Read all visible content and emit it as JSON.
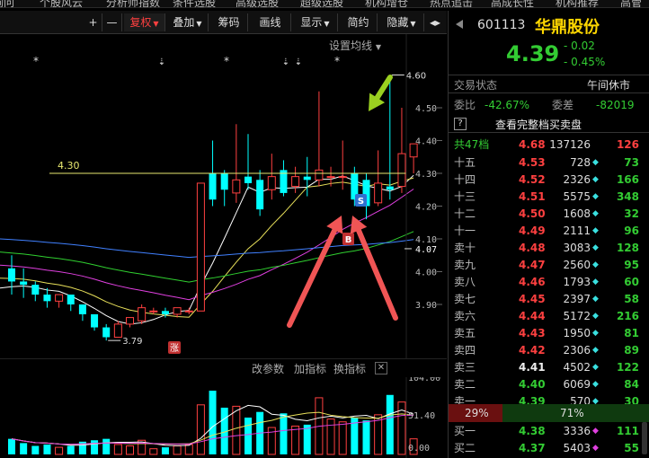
{
  "top_tabs": [
    "询问",
    "个股风云",
    "分析师指数",
    "条件选股",
    "高级选股",
    "超级选股",
    "机构增仓",
    "热点追击",
    "高成长性",
    "机构推荐",
    "高管"
  ],
  "toolbar": {
    "plus": "+",
    "minus": "—",
    "fuquan": "复权",
    "diejia": "叠加",
    "chouma": "筹码",
    "huaxian": "画线",
    "xianshi": "显示",
    "jianyue": "简约",
    "yincang": "隐藏"
  },
  "chart": {
    "settings_label": "设置均线",
    "price_ticks": [
      "4.50",
      "4.40",
      "4.30",
      "4.20",
      "4.10",
      "4.00",
      "3.90"
    ],
    "current_price_tag": "4.07",
    "high_label": "4.60",
    "low_label": "3.79",
    "hline_label": "4.30",
    "badge_zhang": "涨",
    "badge_s": "S",
    "badge_b": "B",
    "star": "*",
    "arrow_down": "⇣",
    "candles": [
      {
        "o": 4.01,
        "c": 3.97,
        "h": 4.05,
        "l": 3.93
      },
      {
        "o": 3.97,
        "c": 3.96,
        "h": 4.01,
        "l": 3.92
      },
      {
        "o": 3.96,
        "c": 3.93,
        "h": 3.97,
        "l": 3.91
      },
      {
        "o": 3.93,
        "c": 3.91,
        "h": 3.95,
        "l": 3.89
      },
      {
        "o": 3.91,
        "c": 3.93,
        "h": 3.93,
        "l": 3.89
      },
      {
        "o": 3.93,
        "c": 3.9,
        "h": 3.93,
        "l": 3.88
      },
      {
        "o": 3.9,
        "c": 3.87,
        "h": 3.9,
        "l": 3.85
      },
      {
        "o": 3.87,
        "c": 3.83,
        "h": 3.87,
        "l": 3.82
      },
      {
        "o": 3.83,
        "c": 3.8,
        "h": 3.84,
        "l": 3.79
      },
      {
        "o": 3.8,
        "c": 3.84,
        "h": 3.85,
        "l": 3.8
      },
      {
        "o": 3.84,
        "c": 3.86,
        "h": 3.86,
        "l": 3.83
      },
      {
        "o": 3.85,
        "c": 3.89,
        "h": 3.9,
        "l": 3.84
      },
      {
        "o": 3.88,
        "c": 3.88,
        "h": 3.89,
        "l": 3.87
      },
      {
        "o": 3.88,
        "c": 3.87,
        "h": 3.89,
        "l": 3.86
      },
      {
        "o": 3.87,
        "c": 3.89,
        "h": 3.89,
        "l": 3.86
      },
      {
        "o": 3.88,
        "c": 3.88,
        "h": 3.89,
        "l": 3.87
      },
      {
        "o": 3.88,
        "c": 4.27,
        "h": 4.27,
        "l": 3.88
      },
      {
        "o": 4.3,
        "c": 4.22,
        "h": 4.4,
        "l": 4.2
      },
      {
        "o": 4.3,
        "c": 4.25,
        "h": 4.31,
        "l": 4.2
      },
      {
        "o": 4.24,
        "c": 4.28,
        "h": 4.45,
        "l": 4.21
      },
      {
        "o": 4.29,
        "c": 4.27,
        "h": 4.42,
        "l": 4.25
      },
      {
        "o": 4.28,
        "c": 4.19,
        "h": 4.31,
        "l": 4.17
      },
      {
        "o": 4.25,
        "c": 4.29,
        "h": 4.36,
        "l": 4.22
      },
      {
        "o": 4.31,
        "c": 4.24,
        "h": 4.34,
        "l": 4.23
      },
      {
        "o": 4.26,
        "c": 4.29,
        "h": 4.32,
        "l": 4.24
      },
      {
        "o": 4.29,
        "c": 4.28,
        "h": 4.35,
        "l": 4.23
      },
      {
        "o": 4.28,
        "c": 4.31,
        "h": 4.55,
        "l": 4.26
      },
      {
        "o": 4.29,
        "c": 4.29,
        "h": 4.32,
        "l": 4.26
      },
      {
        "o": 4.29,
        "c": 4.29,
        "h": 4.4,
        "l": 4.25
      },
      {
        "o": 4.3,
        "c": 4.22,
        "h": 4.32,
        "l": 4.2
      },
      {
        "o": 4.28,
        "c": 4.2,
        "h": 4.3,
        "l": 4.16
      },
      {
        "o": 4.21,
        "c": 4.27,
        "h": 4.37,
        "l": 4.2
      },
      {
        "o": 4.26,
        "c": 4.25,
        "h": 4.6,
        "l": 4.22
      },
      {
        "o": 4.26,
        "c": 4.36,
        "h": 4.5,
        "l": 4.24
      },
      {
        "o": 4.35,
        "c": 4.39,
        "h": 4.39,
        "l": 4.3
      }
    ]
  },
  "indicator": {
    "gaicanshu": "改参数",
    "jiazhibiao": "加指标",
    "huanzhibiao": "换指标",
    "close": "✕",
    "ticks": [
      "104.00",
      "51.40",
      "0.00"
    ]
  },
  "stock": {
    "code": "601113",
    "name": "华鼎股份",
    "price": "4.39",
    "change": "- 0.02",
    "pct": "- 0.45%",
    "status_label": "交易状态",
    "status_value": "午间休市",
    "weibi_label": "委比",
    "weibi_value": "-42.67%",
    "weicha_label": "委差",
    "weicha_value": "-82019",
    "help_glyph": "?",
    "full_book": "查看完整档买卖盘",
    "total_label": "共47档",
    "total_price": "4.68",
    "total_vol": "137126",
    "total_count": "126",
    "sell_pct": "29%",
    "buy_pct": "71%",
    "asks": [
      {
        "label": "十五",
        "price": "4.53",
        "vol": "728",
        "count": "73"
      },
      {
        "label": "十四",
        "price": "4.52",
        "vol": "2326",
        "count": "166"
      },
      {
        "label": "十三",
        "price": "4.51",
        "vol": "5575",
        "count": "348"
      },
      {
        "label": "十二",
        "price": "4.50",
        "vol": "1608",
        "count": "32"
      },
      {
        "label": "十一",
        "price": "4.49",
        "vol": "2111",
        "count": "96"
      },
      {
        "label": "卖十",
        "price": "4.48",
        "vol": "3083",
        "count": "128"
      },
      {
        "label": "卖九",
        "price": "4.47",
        "vol": "2560",
        "count": "95"
      },
      {
        "label": "卖八",
        "price": "4.46",
        "vol": "1793",
        "count": "60"
      },
      {
        "label": "卖七",
        "price": "4.45",
        "vol": "2397",
        "count": "58"
      },
      {
        "label": "卖六",
        "price": "4.44",
        "vol": "5172",
        "count": "216"
      },
      {
        "label": "卖五",
        "price": "4.43",
        "vol": "1950",
        "count": "81"
      },
      {
        "label": "卖四",
        "price": "4.42",
        "vol": "2306",
        "count": "89"
      },
      {
        "label": "卖三",
        "price": "4.41",
        "vol": "4502",
        "count": "122"
      },
      {
        "label": "卖二",
        "price": "4.40",
        "vol": "6069",
        "count": "84"
      },
      {
        "label": "卖一",
        "price": "4.39",
        "vol": "570",
        "count": "30"
      }
    ],
    "bids": [
      {
        "label": "买一",
        "price": "4.38",
        "vol": "3336",
        "count": "111"
      },
      {
        "label": "买二",
        "price": "4.37",
        "vol": "5403",
        "count": "55"
      }
    ]
  },
  "colors": {
    "up": "#ff4040",
    "down": "#00ffff",
    "accent": "#ffd700"
  }
}
